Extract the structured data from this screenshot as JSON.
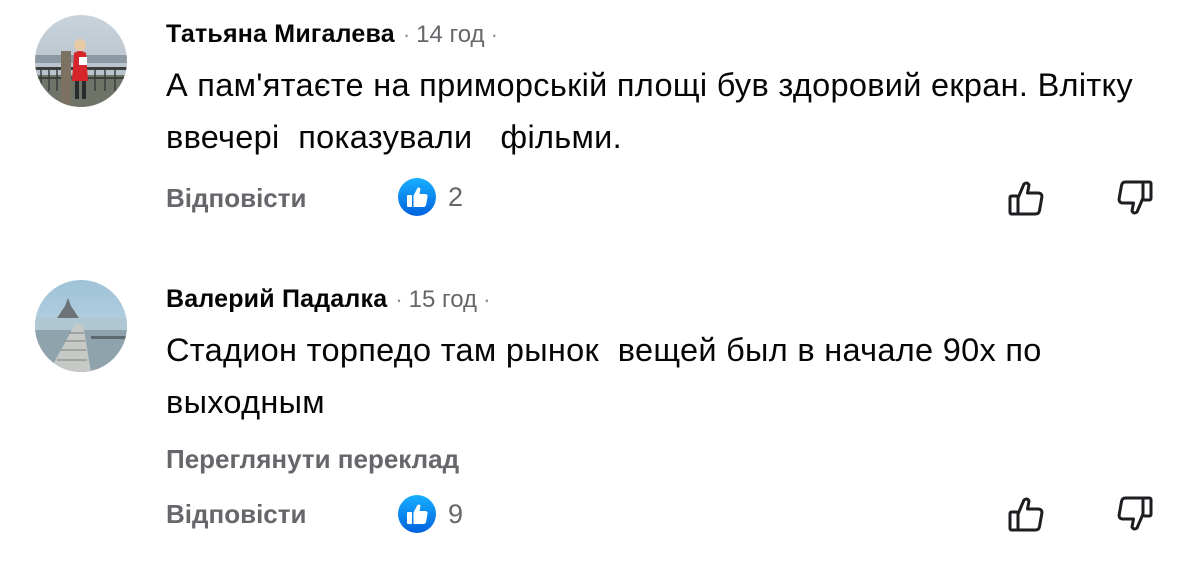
{
  "colors": {
    "text_primary": "#050505",
    "text_secondary": "#65676b",
    "like_badge": "#1877f2",
    "icon_stroke": "#1c1e21"
  },
  "comments": [
    {
      "author": "Татьяна Мигалева",
      "time": "14 год",
      "separator": "·",
      "text": "А пам'ятаєте на приморській площі був здоровий екран. Влітку  ввечері  показували   фільми.",
      "reply_label": "Відповісти",
      "like_count": "2",
      "like_icon": "like-thumb-icon",
      "upvote_icon": "thumbs-up-outline-icon",
      "downvote_icon": "thumbs-down-outline-icon"
    },
    {
      "author": "Валерий Падалка",
      "time": "15 год",
      "separator": "·",
      "text": "Стадион торпедо там рынок  вещей был в начале 90х по выходным",
      "translate_label": "Переглянути переклад",
      "reply_label": "Відповісти",
      "like_count": "9",
      "like_icon": "like-thumb-icon",
      "upvote_icon": "thumbs-up-outline-icon",
      "downvote_icon": "thumbs-down-outline-icon"
    }
  ]
}
